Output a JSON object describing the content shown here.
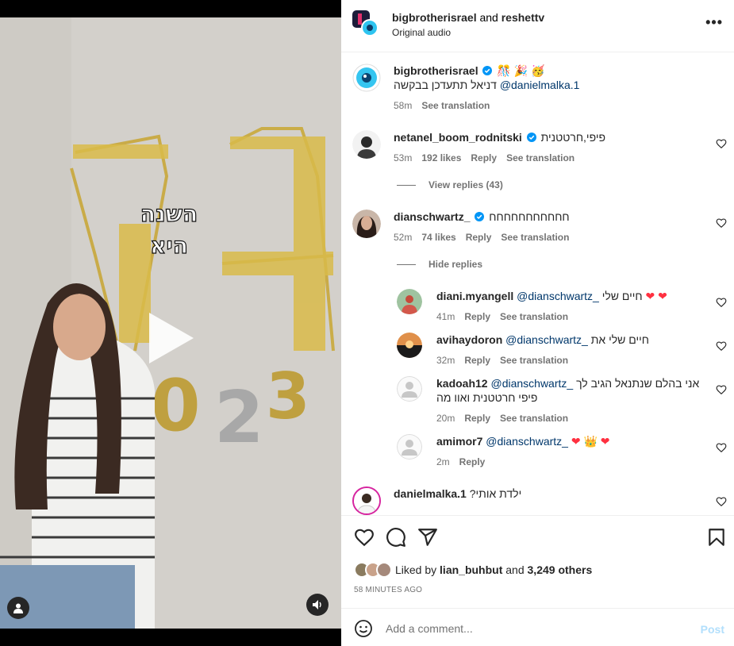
{
  "post": {
    "author": "bigbrotherisrael",
    "joiner": "and",
    "coauthor": "reshettv",
    "audio": "Original audio",
    "more_icon": "more-options-icon"
  },
  "video": {
    "overlay_text": "השנה היא",
    "play_icon": "play-icon",
    "user_icon": "user-tag-icon",
    "sound_icon": "speaker-icon"
  },
  "caption": {
    "username": "bigbrotherisrael",
    "emojis": "🎊 🎉 🥳",
    "text": "דניאל תתעדכן בבקשה",
    "mention": "@danielmalka.1",
    "time": "58m",
    "translate": "See translation"
  },
  "comments": [
    {
      "username": "netanel_boom_rodnitski",
      "text": "פיפי,חרטטנית",
      "time": "53m",
      "likes": "192 likes",
      "reply": "Reply",
      "translate": "See translation",
      "replies_toggle": "View replies (43)"
    },
    {
      "username": "dianschwartz_",
      "text": "חחחחחחחחחחח",
      "time": "52m",
      "likes": "74 likes",
      "reply": "Reply",
      "translate": "See translation",
      "replies_toggle": "Hide replies"
    }
  ],
  "replies": [
    {
      "username": "diani.myangell",
      "mention": "@dianschwartz_",
      "text": "חיים שלי",
      "time": "41m",
      "reply": "Reply",
      "translate": "See translation"
    },
    {
      "username": "avihaydoron",
      "mention": "@dianschwartz_",
      "text": "חיים שלי את",
      "time": "32m",
      "reply": "Reply",
      "translate": "See translation"
    },
    {
      "username": "kadoah12",
      "mention": "@dianschwartz_",
      "text": "אני בהלם שנתנאל הגיב לך",
      "text2": "פיפי חרטטנית ואוו מה",
      "time": "20m",
      "reply": "Reply",
      "translate": "See translation"
    },
    {
      "username": "amimor7",
      "mention": "@dianschwartz_",
      "time": "2m",
      "reply": "Reply"
    }
  ],
  "last_comment": {
    "username": "danielmalka.1",
    "text": "ילדת אותי?"
  },
  "actions": {
    "liked_by_prefix": "Liked by",
    "liked_by_user": "lian_buhbut",
    "liked_by_joiner": "and",
    "others": "3,249 others",
    "timestamp": "58 MINUTES AGO"
  },
  "composer": {
    "placeholder": "Add a comment...",
    "post_label": "Post"
  },
  "colors": {
    "verified": "#0095f6",
    "link": "#00376b",
    "heart": "#ff3040",
    "post_disabled": "#b2dffc"
  }
}
